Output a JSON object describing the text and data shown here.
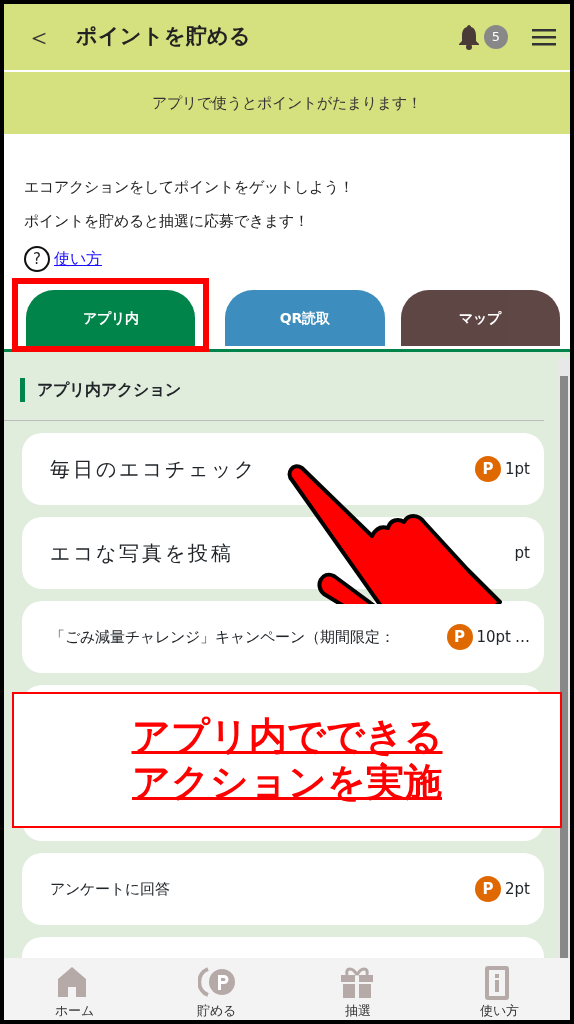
{
  "header": {
    "back": "＜",
    "title": "ポイントを貯める",
    "notification_count": "5"
  },
  "banner": "アプリで使うとポイントがたまります！",
  "intro": [
    "エコアクションをしてポイントをゲットしよう！",
    "ポイントを貯めると抽選に応募できます！"
  ],
  "help_link": {
    "icon_text": "?",
    "label": "使い方"
  },
  "tabs": [
    {
      "label": "アプリ内",
      "selected": true,
      "color": "#00844a",
      "highlighted": true
    },
    {
      "label": "QR読取",
      "selected": false,
      "color": "#3388bb",
      "highlighted": false
    },
    {
      "label": "マップ",
      "selected": false,
      "color": "#553d3b",
      "highlighted": false
    }
  ],
  "section_title": "アプリ内アクション",
  "actions": [
    {
      "kind": "large",
      "title": "毎日のエコチェック",
      "points": "1pt",
      "points_icon": "P"
    },
    {
      "kind": "large",
      "title": "エコな写真を投稿",
      "points": "pt"
    },
    {
      "kind": "normal",
      "title": "「ごみ減量チャレンジ」キャンペーン（期間限定：",
      "points": "10pt",
      "points_icon": "P",
      "overflow": "…"
    },
    {
      "kind": "covered"
    },
    {
      "kind": "covered"
    },
    {
      "kind": "normal",
      "title": "アンケートに回答",
      "points": "2pt",
      "points_icon": "P"
    },
    {
      "kind": "covered"
    }
  ],
  "callout": [
    "アプリ内でできる",
    "アクションを実施"
  ],
  "bottom_nav": [
    {
      "label": "ホーム"
    },
    {
      "label": "貯める"
    },
    {
      "label": "抽選"
    },
    {
      "label": "使い方"
    }
  ]
}
